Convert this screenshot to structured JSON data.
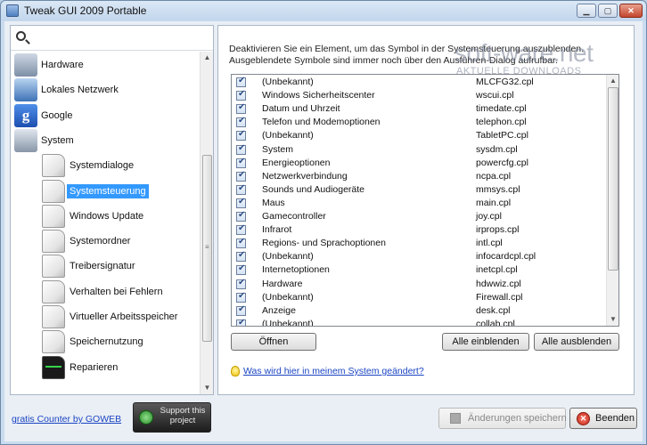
{
  "window": {
    "title": "Tweak GUI 2009 Portable"
  },
  "nav": {
    "search_placeholder": "",
    "items": [
      {
        "label": "Hardware",
        "icon": "hardware-icon",
        "level": 0
      },
      {
        "label": "Lokales Netzwerk",
        "icon": "network-icon",
        "level": 0
      },
      {
        "label": "Google",
        "icon": "google-icon",
        "level": 0
      },
      {
        "label": "System",
        "icon": "system-icon",
        "level": 0
      },
      {
        "label": "Systemdialoge",
        "icon": "page-icon",
        "level": 1
      },
      {
        "label": "Systemsteuerung",
        "icon": "page-icon",
        "level": 1,
        "selected": true
      },
      {
        "label": "Windows Update",
        "icon": "page-icon",
        "level": 1
      },
      {
        "label": "Systemordner",
        "icon": "page-icon",
        "level": 1
      },
      {
        "label": "Treibersignatur",
        "icon": "page-icon",
        "level": 1
      },
      {
        "label": "Verhalten bei Fehlern",
        "icon": "page-icon",
        "level": 1
      },
      {
        "label": "Virtueller Arbeitsspeicher",
        "icon": "page-icon",
        "level": 1
      },
      {
        "label": "Speichernutzung",
        "icon": "page-icon",
        "level": 1
      },
      {
        "label": "Reparieren",
        "icon": "monitor-icon",
        "level": 1
      }
    ]
  },
  "panel": {
    "description": "Deaktivieren Sie ein Element, um das Symbol in der Systemsteuerung auszublenden. Ausgeblendete Symbole sind immer noch über den Ausführen-Dialog aufrufbar.",
    "rows": [
      {
        "name": "(Unbekannt)",
        "file": "MLCFG32.cpl",
        "checked": true
      },
      {
        "name": "Windows Sicherheitscenter",
        "file": "wscui.cpl",
        "checked": true
      },
      {
        "name": "Datum und Uhrzeit",
        "file": "timedate.cpl",
        "checked": true
      },
      {
        "name": "Telefon und Modemoptionen",
        "file": "telephon.cpl",
        "checked": true
      },
      {
        "name": "(Unbekannt)",
        "file": "TabletPC.cpl",
        "checked": true
      },
      {
        "name": "System",
        "file": "sysdm.cpl",
        "checked": true
      },
      {
        "name": "Energieoptionen",
        "file": "powercfg.cpl",
        "checked": true
      },
      {
        "name": "Netzwerkverbindung",
        "file": "ncpa.cpl",
        "checked": true
      },
      {
        "name": "Sounds und Audiogeräte",
        "file": "mmsys.cpl",
        "checked": true
      },
      {
        "name": "Maus",
        "file": "main.cpl",
        "checked": true
      },
      {
        "name": "Gamecontroller",
        "file": "joy.cpl",
        "checked": true
      },
      {
        "name": "Infrarot",
        "file": "irprops.cpl",
        "checked": true
      },
      {
        "name": "Regions- und Sprachoptionen",
        "file": "intl.cpl",
        "checked": true
      },
      {
        "name": "(Unbekannt)",
        "file": "infocardcpl.cpl",
        "checked": true
      },
      {
        "name": "Internetoptionen",
        "file": "inetcpl.cpl",
        "checked": true
      },
      {
        "name": "Hardware",
        "file": "hdwwiz.cpl",
        "checked": true
      },
      {
        "name": "(Unbekannt)",
        "file": "Firewall.cpl",
        "checked": true
      },
      {
        "name": "Anzeige",
        "file": "desk.cpl",
        "checked": true
      },
      {
        "name": "(Unbekannt)",
        "file": "collab.cpl",
        "checked": true
      }
    ],
    "open_label": "Öffnen",
    "show_all_label": "Alle einblenden",
    "hide_all_label": "Alle ausblenden",
    "help_link": "Was wird hier in meinem System geändert?"
  },
  "watermark": {
    "main": "soft-ware.net",
    "sub": "AKTUELLE DOWNLOADS"
  },
  "footer": {
    "counter_link": "gratis Counter by GOWEB",
    "support_label": "Support this project",
    "save_label": "Änderungen speichern",
    "exit_label": "Beenden"
  },
  "colors": {
    "selection": "#3399ff",
    "link": "#1a44c2",
    "window_frame": "#c9dcef"
  }
}
